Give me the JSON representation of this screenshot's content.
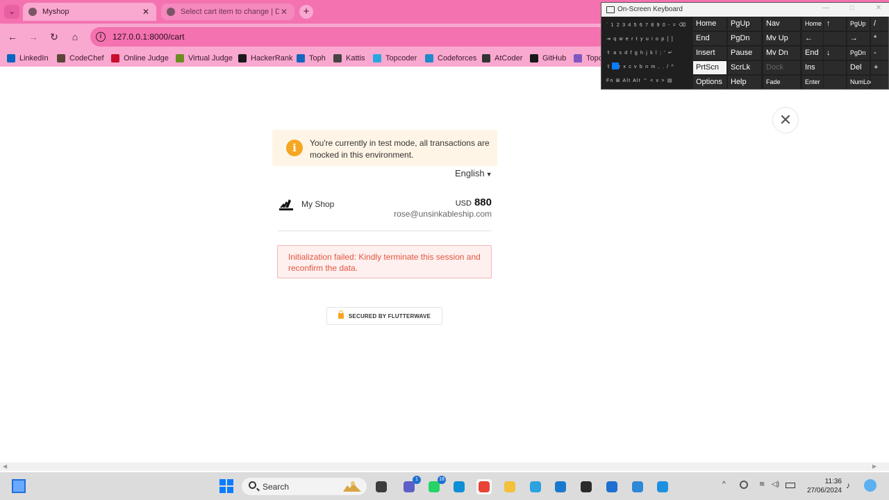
{
  "browser": {
    "tabs": [
      {
        "title": "Myshop",
        "active": true
      },
      {
        "title": "Select cart item to change | Dja",
        "active": false
      }
    ],
    "new_tab_label": "+",
    "close_glyph": "✕",
    "url": "127.0.0.1:8000/cart",
    "nav": {
      "back": "←",
      "forward": "→",
      "reload": "↻",
      "home": "⌂"
    },
    "bookmarks": [
      {
        "label": "LinkedIn",
        "color": "#0a66c2"
      },
      {
        "label": "CodeChef",
        "color": "#5b4638"
      },
      {
        "label": "Online Judge",
        "color": "#c8102e"
      },
      {
        "label": "Virtual Judge",
        "color": "#6b8e23"
      },
      {
        "label": "HackerRank",
        "color": "#1b1b1b"
      },
      {
        "label": "Toph",
        "color": "#1565c0"
      },
      {
        "label": "Kattis",
        "color": "#444444"
      },
      {
        "label": "Topcoder",
        "color": "#29a8e0"
      },
      {
        "label": "Codeforces",
        "color": "#1f8acb"
      },
      {
        "label": "AtCoder",
        "color": "#333333"
      },
      {
        "label": "GitHub",
        "color": "#181717"
      },
      {
        "label": "Topc",
        "color": "#7e57c2"
      }
    ]
  },
  "checkout": {
    "notice": "You're currently in test mode, all transactions are mocked in this environment.",
    "language": "English",
    "merchant": {
      "name": "My Shop",
      "logo_text": "Adidas"
    },
    "amount": {
      "currency": "USD",
      "value": "880"
    },
    "email": "rose@unsinkableship.com",
    "error": "Initialization failed: Kindly terminate this session and reconfirm the data.",
    "secured_label": "SECURED BY FLUTTERWAVE",
    "close_glyph": "✕"
  },
  "keyboard": {
    "title": "On-Screen Keyboard",
    "mini_rows": [
      "` 1 2 3 4 5 6 7 8 9 0 - = ⌫",
      "⇥ q w e r t y u i o p [ ]",
      "⇪ a s d f g h j k l ; ' ↵",
      "⇧ \\ z x c v b n m , . / ^",
      "Fn ⊞ Alt           Alt ⌃ < v > ▤"
    ],
    "keys": [
      {
        "label": "Home",
        "col": 0,
        "row": 0
      },
      {
        "label": "PgUp",
        "col": 1,
        "row": 0
      },
      {
        "label": "Nav",
        "col": 2,
        "row": 0
      },
      {
        "label": "Home",
        "col": 3,
        "row": 0,
        "small": true
      },
      {
        "label": "↑",
        "col": 4,
        "row": 0
      },
      {
        "label": "PgUp",
        "col": 5,
        "row": 0,
        "small": true
      },
      {
        "label": "/",
        "col": 6,
        "row": 0
      },
      {
        "label": "End",
        "col": 0,
        "row": 1
      },
      {
        "label": "PgDn",
        "col": 1,
        "row": 1
      },
      {
        "label": "Mv Up",
        "col": 2,
        "row": 1
      },
      {
        "label": "←",
        "col": 3,
        "row": 1
      },
      {
        "label": "",
        "col": 4,
        "row": 1
      },
      {
        "label": "→",
        "col": 5,
        "row": 1
      },
      {
        "label": "*",
        "col": 6,
        "row": 1
      },
      {
        "label": "Insert",
        "col": 0,
        "row": 2
      },
      {
        "label": "Pause",
        "col": 1,
        "row": 2
      },
      {
        "label": "Mv Dn",
        "col": 2,
        "row": 2
      },
      {
        "label": "End",
        "col": 3,
        "row": 2
      },
      {
        "label": "↓",
        "col": 4,
        "row": 2
      },
      {
        "label": "PgDn",
        "col": 5,
        "row": 2,
        "small": true
      },
      {
        "label": "-",
        "col": 6,
        "row": 2
      },
      {
        "label": "PrtScn",
        "col": 0,
        "row": 3,
        "lit": true
      },
      {
        "label": "ScrLk",
        "col": 1,
        "row": 3
      },
      {
        "label": "Dock",
        "col": 2,
        "row": 3,
        "dim": true
      },
      {
        "label": "Ins",
        "col": 3,
        "row": 3
      },
      {
        "label": "",
        "col": 4,
        "row": 3
      },
      {
        "label": "Del",
        "col": 5,
        "row": 3
      },
      {
        "label": "+",
        "col": 6,
        "row": 3
      },
      {
        "label": "Options",
        "col": 0,
        "row": 4
      },
      {
        "label": "Help",
        "col": 1,
        "row": 4
      },
      {
        "label": "Fade",
        "col": 2,
        "row": 4,
        "small": true
      },
      {
        "label": "Enter",
        "col": 3,
        "row": 4,
        "small": true
      },
      {
        "label": "",
        "col": 4,
        "row": 4
      },
      {
        "label": "NumLock",
        "col": 5,
        "row": 4,
        "small": true
      },
      {
        "label": "",
        "col": 6,
        "row": 4
      }
    ]
  },
  "taskbar": {
    "search_label": "Search",
    "apps": [
      {
        "name": "file-explorer-dark",
        "color": "#3c3c3c"
      },
      {
        "name": "teams",
        "color": "#5b5fc7",
        "badge": "1"
      },
      {
        "name": "whatsapp",
        "color": "#25d366",
        "badge": "18"
      },
      {
        "name": "edge",
        "color": "#0f8fd4"
      },
      {
        "name": "chrome",
        "color": "#e94335",
        "active": true
      },
      {
        "name": "file-explorer",
        "color": "#f3c13a"
      },
      {
        "name": "telegram",
        "color": "#2aa3de"
      },
      {
        "name": "vscode",
        "color": "#1a79cc"
      },
      {
        "name": "terminal",
        "color": "#2b2b2b"
      },
      {
        "name": "store",
        "color": "#1d6fd1"
      },
      {
        "name": "remote-desktop",
        "color": "#2e88d8"
      },
      {
        "name": "snipping-tool",
        "color": "#1e90e0"
      }
    ],
    "time": "11:36",
    "date": "27/06/2024"
  }
}
